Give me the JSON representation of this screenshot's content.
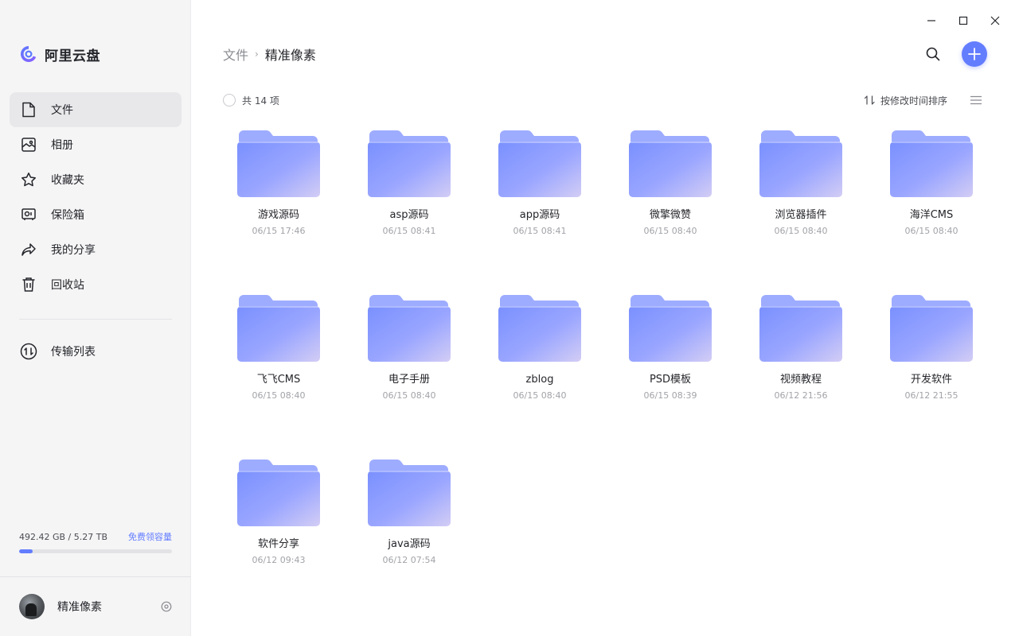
{
  "app": {
    "name": "阿里云盘"
  },
  "colors": {
    "accent": "#637dff",
    "folder_light": "#9eacff",
    "folder_dark": "#7a90ff",
    "folder_tint": "#cfcbf5"
  },
  "sidebar": {
    "items": [
      {
        "label": "文件",
        "icon": "file-icon",
        "active": true
      },
      {
        "label": "相册",
        "icon": "photo-icon",
        "active": false
      },
      {
        "label": "收藏夹",
        "icon": "star-icon",
        "active": false
      },
      {
        "label": "保险箱",
        "icon": "safe-icon",
        "active": false
      },
      {
        "label": "我的分享",
        "icon": "share-icon",
        "active": false
      },
      {
        "label": "回收站",
        "icon": "trash-icon",
        "active": false
      }
    ],
    "secondary": [
      {
        "label": "传输列表",
        "icon": "transfer-icon"
      }
    ],
    "storage": {
      "used_label": "492.42 GB / 5.27 TB",
      "link": "免费领容量",
      "fraction": 0.091
    },
    "user": {
      "name": "精准像素"
    }
  },
  "header": {
    "breadcrumb_root": "文件",
    "breadcrumb_sep": "›",
    "breadcrumb_current": "精准像素"
  },
  "toolbar": {
    "count_label": "共 14 项",
    "sort_label": "按修改时间排序"
  },
  "files": [
    {
      "name": "游戏源码",
      "date": "06/15 17:46"
    },
    {
      "name": "asp源码",
      "date": "06/15 08:41"
    },
    {
      "name": "app源码",
      "date": "06/15 08:41"
    },
    {
      "name": "微擎微赞",
      "date": "06/15 08:40"
    },
    {
      "name": "浏览器插件",
      "date": "06/15 08:40"
    },
    {
      "name": "海洋CMS",
      "date": "06/15 08:40"
    },
    {
      "name": "飞飞CMS",
      "date": "06/15 08:40"
    },
    {
      "name": "电子手册",
      "date": "06/15 08:40"
    },
    {
      "name": "zblog",
      "date": "06/15 08:40"
    },
    {
      "name": "PSD模板",
      "date": "06/15 08:39"
    },
    {
      "name": "视频教程",
      "date": "06/12 21:56"
    },
    {
      "name": "开发软件",
      "date": "06/12 21:55"
    },
    {
      "name": "软件分享",
      "date": "06/12 09:43"
    },
    {
      "name": "java源码",
      "date": "06/12 07:54"
    }
  ]
}
